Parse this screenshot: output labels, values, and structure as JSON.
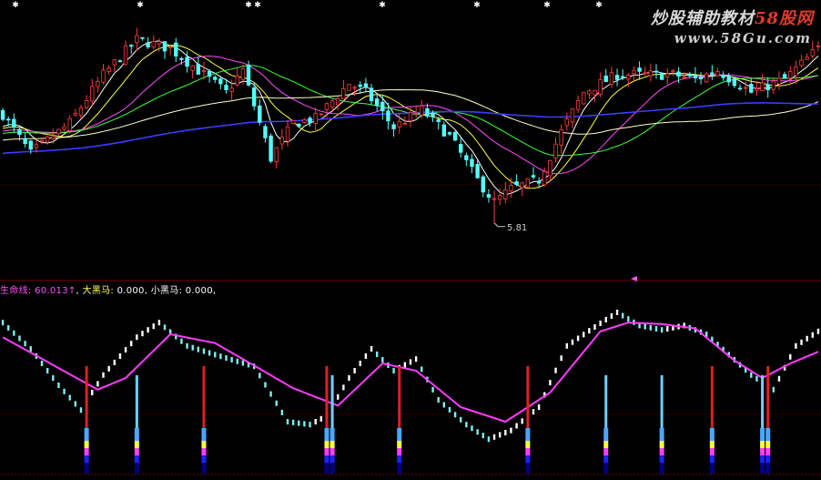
{
  "watermark": {
    "line1_prefix": "炒股辅助教材",
    "line1_brand": "58股网",
    "line2": "www.58Gu.com"
  },
  "legend": {
    "item1_label": "生命线",
    "item1_value": "60.013",
    "item1_arrow": "↑",
    "item2_label": "大黑马",
    "item2_value": "0.000",
    "item3_label": "小黑马",
    "item3_value": "0.000",
    "sep": ":",
    "comma": ","
  },
  "colors": {
    "bull": "#ff3c3c",
    "bear": "#54ffff",
    "ma5": "#ffffff",
    "ma10": "#ffff3c",
    "ma20": "#ff4cff",
    "ma30": "#3cff3c",
    "ma60": "#ffffc8",
    "ma120": "#3c3cff",
    "lifeline": "#ff3cff",
    "indicator_up": "#ffffff",
    "indicator_down": "#7ef0f0",
    "label_lifeline": "#ff50ff",
    "label_big": "#ffff50",
    "label_small": "#ffffff",
    "grid": "#7a0000"
  },
  "chart_data": {
    "type": "candlestick",
    "low_annotation": {
      "text": "5.81",
      "value": 5.81
    },
    "price_range": [
      5.6,
      8.3
    ],
    "price_path_keys": [
      {
        "i": 0,
        "p": 7.05
      },
      {
        "i": 5,
        "p": 6.6
      },
      {
        "i": 12,
        "p": 6.95
      },
      {
        "i": 18,
        "p": 7.5
      },
      {
        "i": 24,
        "p": 7.9
      },
      {
        "i": 30,
        "p": 7.8
      },
      {
        "i": 35,
        "p": 7.55
      },
      {
        "i": 40,
        "p": 7.3
      },
      {
        "i": 43,
        "p": 7.55
      },
      {
        "i": 48,
        "p": 6.55
      },
      {
        "i": 52,
        "p": 6.95
      },
      {
        "i": 56,
        "p": 7.0
      },
      {
        "i": 62,
        "p": 7.4
      },
      {
        "i": 65,
        "p": 7.3
      },
      {
        "i": 70,
        "p": 6.9
      },
      {
        "i": 75,
        "p": 7.1
      },
      {
        "i": 80,
        "p": 6.8
      },
      {
        "i": 85,
        "p": 6.3
      },
      {
        "i": 88,
        "p": 6.05
      },
      {
        "i": 91,
        "p": 6.2
      },
      {
        "i": 96,
        "p": 6.3
      },
      {
        "i": 100,
        "p": 6.85
      },
      {
        "i": 104,
        "p": 7.3
      },
      {
        "i": 110,
        "p": 7.5
      },
      {
        "i": 116,
        "p": 7.5
      },
      {
        "i": 120,
        "p": 7.5
      },
      {
        "i": 124,
        "p": 7.45
      },
      {
        "i": 128,
        "p": 7.55
      },
      {
        "i": 134,
        "p": 7.3
      },
      {
        "i": 140,
        "p": 7.45
      },
      {
        "i": 146,
        "p": 7.8
      }
    ],
    "ma_lines": [
      {
        "name": "MA5",
        "period": 5
      },
      {
        "name": "MA10",
        "period": 10
      },
      {
        "name": "MA20",
        "period": 20
      },
      {
        "name": "MA30",
        "period": 30
      },
      {
        "name": "MA60",
        "period": 60
      },
      {
        "name": "MA120",
        "period": 120
      }
    ],
    "indicator": {
      "range": [
        0,
        100
      ],
      "osc_keys": [
        {
          "i": 0,
          "v": 88
        },
        {
          "i": 5,
          "v": 70
        },
        {
          "i": 10,
          "v": 45
        },
        {
          "i": 14,
          "v": 28
        },
        {
          "i": 18,
          "v": 52
        },
        {
          "i": 24,
          "v": 78
        },
        {
          "i": 28,
          "v": 88
        },
        {
          "i": 33,
          "v": 72
        },
        {
          "i": 38,
          "v": 66
        },
        {
          "i": 45,
          "v": 58
        },
        {
          "i": 51,
          "v": 20
        },
        {
          "i": 55,
          "v": 18
        },
        {
          "i": 58,
          "v": 24
        },
        {
          "i": 62,
          "v": 50
        },
        {
          "i": 66,
          "v": 70
        },
        {
          "i": 70,
          "v": 55
        },
        {
          "i": 74,
          "v": 63
        },
        {
          "i": 78,
          "v": 35
        },
        {
          "i": 83,
          "v": 18
        },
        {
          "i": 87,
          "v": 8
        },
        {
          "i": 91,
          "v": 14
        },
        {
          "i": 96,
          "v": 30
        },
        {
          "i": 101,
          "v": 72
        },
        {
          "i": 106,
          "v": 85
        },
        {
          "i": 110,
          "v": 95
        },
        {
          "i": 114,
          "v": 86
        },
        {
          "i": 118,
          "v": 83
        },
        {
          "i": 122,
          "v": 86
        },
        {
          "i": 126,
          "v": 80
        },
        {
          "i": 130,
          "v": 66
        },
        {
          "i": 134,
          "v": 52
        },
        {
          "i": 138,
          "v": 42
        },
        {
          "i": 142,
          "v": 72
        },
        {
          "i": 146,
          "v": 82
        }
      ],
      "lifeline_keys": [
        {
          "i": 0,
          "v": 78
        },
        {
          "i": 17,
          "v": 42
        },
        {
          "i": 22,
          "v": 50
        },
        {
          "i": 30,
          "v": 80
        },
        {
          "i": 38,
          "v": 74
        },
        {
          "i": 52,
          "v": 43
        },
        {
          "i": 60,
          "v": 31
        },
        {
          "i": 68,
          "v": 60
        },
        {
          "i": 74,
          "v": 55
        },
        {
          "i": 82,
          "v": 30
        },
        {
          "i": 90,
          "v": 20
        },
        {
          "i": 98,
          "v": 40
        },
        {
          "i": 107,
          "v": 82
        },
        {
          "i": 112,
          "v": 88
        },
        {
          "i": 118,
          "v": 87
        },
        {
          "i": 124,
          "v": 84
        },
        {
          "i": 131,
          "v": 62
        },
        {
          "i": 136,
          "v": 50
        },
        {
          "i": 141,
          "v": 60
        },
        {
          "i": 146,
          "v": 68
        }
      ],
      "signals": [
        {
          "i": 15,
          "type": "big"
        },
        {
          "i": 24,
          "type": "small"
        },
        {
          "i": 36,
          "type": "big"
        },
        {
          "i": 58,
          "type": "big"
        },
        {
          "i": 59,
          "type": "small"
        },
        {
          "i": 71,
          "type": "big"
        },
        {
          "i": 94,
          "type": "big"
        },
        {
          "i": 108,
          "type": "small"
        },
        {
          "i": 118,
          "type": "small"
        },
        {
          "i": 127,
          "type": "big"
        },
        {
          "i": 136,
          "type": "small"
        },
        {
          "i": 137,
          "type": "big"
        }
      ]
    }
  }
}
